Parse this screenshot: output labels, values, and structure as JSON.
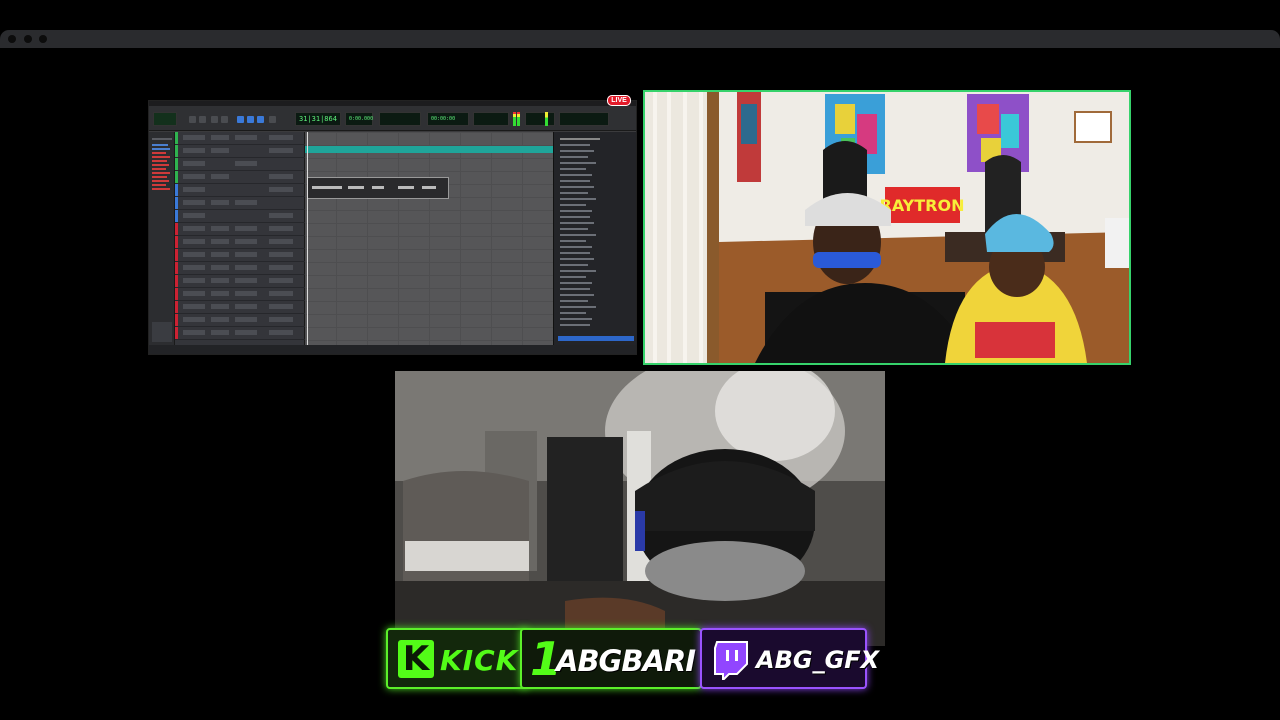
{
  "live_badge": "LIVE",
  "daw": {
    "counter_main": "31|31|864",
    "counter_sub": "0:00.000",
    "counter_right": "00:00:00"
  },
  "camera_art": {
    "sign_text": "RAYTRON"
  },
  "banner": {
    "kick_label": "KICK",
    "kick_logo_letter": "K",
    "channel_number": "1",
    "channel_name": "ABGBARI",
    "twitch_handle": "ABG_GFX"
  },
  "colors": {
    "kick_green": "#53fc18",
    "twitch_purple": "#9146ff",
    "live_red": "#e21b2a",
    "cam_border_green": "#36d26b"
  }
}
